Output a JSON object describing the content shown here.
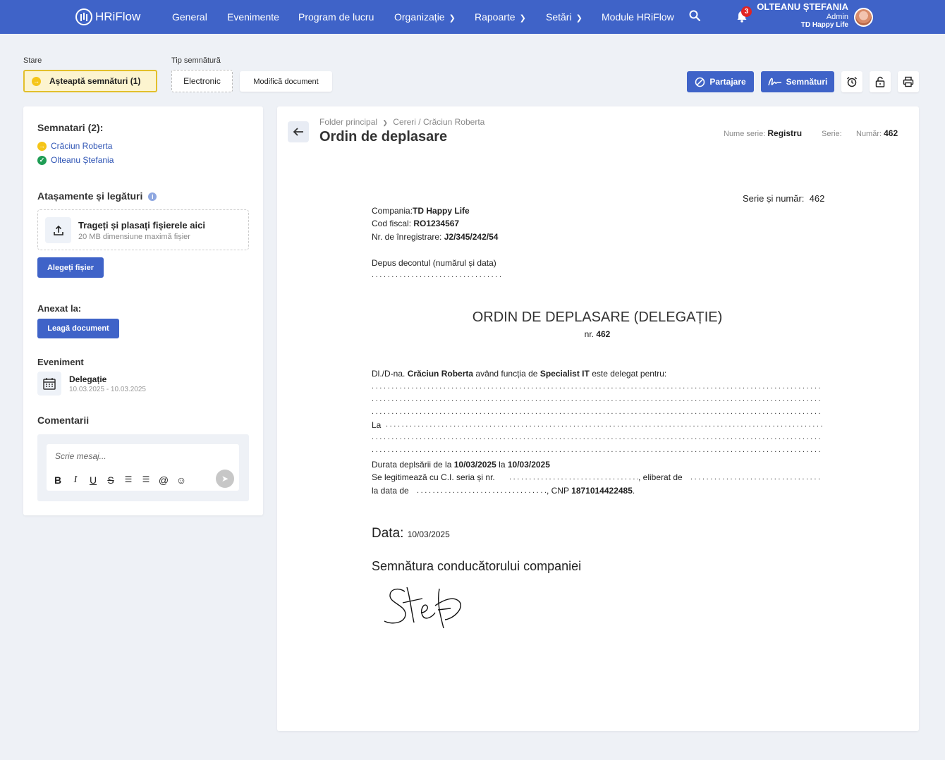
{
  "app": {
    "logo_text": "HRiFlow",
    "nav": [
      {
        "label": "General",
        "has_chevron": false
      },
      {
        "label": "Evenimente",
        "has_chevron": false
      },
      {
        "label": "Program de lucru",
        "has_chevron": false
      },
      {
        "label": "Organizație",
        "has_chevron": true
      },
      {
        "label": "Rapoarte",
        "has_chevron": true
      },
      {
        "label": "Setări",
        "has_chevron": true
      },
      {
        "label": "Module HRiFlow",
        "has_chevron": false
      }
    ],
    "notifications_count": "3",
    "user": {
      "name": "OLTEANU ȘTEFANIA",
      "role": "Admin",
      "company": "TD Happy Life"
    },
    "accent_color": "#3f63c8"
  },
  "toolbar": {
    "status_label": "Stare",
    "status_value": "Așteaptă semnături (1)",
    "signature_type_label": "Tip semnătură",
    "signature_type_value": "Electronic",
    "modify_document": "Modifică document",
    "share_button": "Partajare",
    "signatures_button": "Semnături",
    "icons": [
      "alarm-clock-icon",
      "lock-icon",
      "printer-icon"
    ]
  },
  "left": {
    "signers_title": "Semnatari (2):",
    "signers": [
      {
        "name": "Crăciun Roberta",
        "status": "pending",
        "color": "#f5c518"
      },
      {
        "name": "Olteanu Ștefania",
        "status": "signed",
        "color": "#1f9d55"
      }
    ],
    "attachments_title": "Atașamente și legături",
    "dropzone_title": "Trageți și plasați fișierele aici",
    "dropzone_sub": "20 MB dimensiune maximă fișier",
    "choose_file": "Alegeți fișier",
    "annexed_title": "Anexat la:",
    "link_document": "Leagă document",
    "event_title": "Eveniment",
    "event_name": "Delegație",
    "event_dates": "10.03.2025 - 10.03.2025",
    "comments_title": "Comentarii",
    "comment_placeholder": "Scrie mesaj..."
  },
  "document_header": {
    "breadcrumb": [
      "Folder principal",
      "Cereri / Crăciun Roberta"
    ],
    "title": "Ordin de deplasare",
    "series_name_label": "Nume serie:",
    "series_name_value": "Registru",
    "series_label": "Serie:",
    "series_value": "",
    "number_label": "Număr:",
    "number_value": "462"
  },
  "document": {
    "serie_nr_label": "Serie și număr:",
    "serie_nr_value": "462",
    "company_label": "Compania:",
    "company_value": "TD Happy Life",
    "fiscal_label": "Cod fiscal:",
    "fiscal_value": "RO1234567",
    "reg_label": "Nr. de înregistrare:",
    "reg_value": "J2/345/242/54",
    "deposit_label": "Depus decontul (numărul și data)",
    "heading": "ORDIN DE DEPLASARE (DELEGAȚIE)",
    "nr_label": "nr.",
    "nr_value": "462",
    "person_prefix": "Dl./D-na.",
    "person_name": "Crăciun Roberta",
    "person_mid": "având funcția de",
    "person_role": "Specialist IT",
    "person_suffix": "este delegat pentru:",
    "la_label": "La",
    "duration_prefix": "Durata deplsării de la",
    "duration_from": "10/03/2025",
    "duration_mid": "la",
    "duration_to": "10/03/2025",
    "id_prefix": "Se legitimează cu C.I. seria și nr.",
    "id_issued": ", eliberat de",
    "date_prefix": "la data de",
    "cnp_label": ", CNP",
    "cnp_value": "1871014422485",
    "date_label": "Data:",
    "date_value": "10/03/2025",
    "signature_label": "Semnătura conducătorului companiei"
  }
}
